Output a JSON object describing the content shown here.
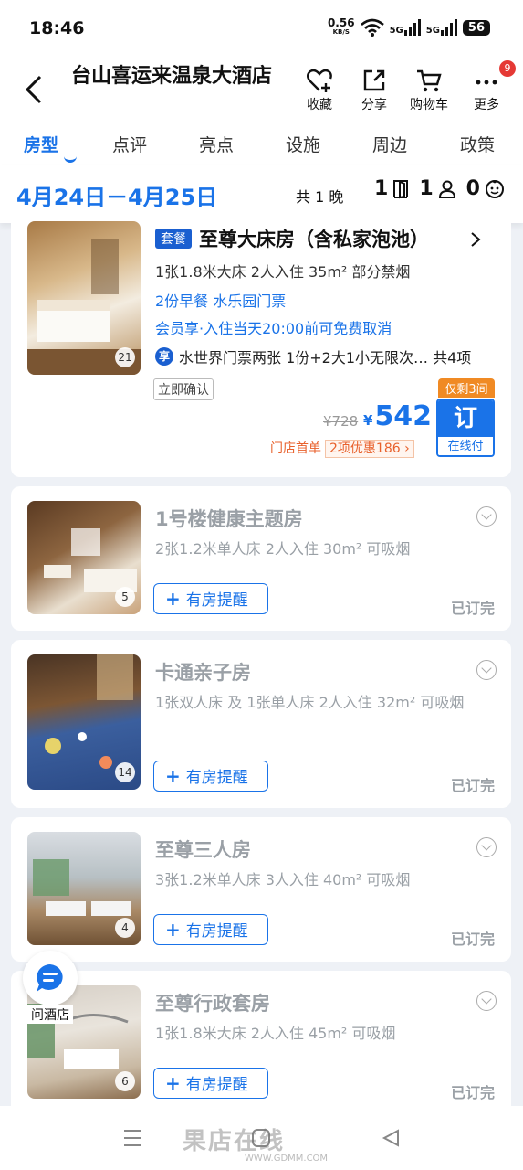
{
  "status": {
    "time": "18:46",
    "net_speed": "0.56",
    "net_unit": "KB/S",
    "sig1": "5G",
    "sig2": "5G",
    "battery": "56"
  },
  "header": {
    "title": "台山喜运来温泉大酒店",
    "actions": [
      {
        "label": "收藏",
        "icon": "heart-plus-icon"
      },
      {
        "label": "分享",
        "icon": "share-icon"
      },
      {
        "label": "购物车",
        "icon": "cart-icon"
      },
      {
        "label": "更多",
        "icon": "more-icon",
        "badge": "9"
      }
    ]
  },
  "tabs": [
    "房型",
    "点评",
    "亮点",
    "设施",
    "周边",
    "政策"
  ],
  "datebar": {
    "dates": "4月24日－4月25日",
    "nights": "共 1 晚",
    "rooms": "1",
    "adults": "1",
    "children": "0"
  },
  "featured": {
    "tag": "套餐",
    "name": "至尊大床房（含私家泡池）",
    "spec": "1张1.8米大床   2人入住   35m²   部分禁烟",
    "extras": "2份早餐   水乐园门票",
    "member": "会员享·入住当天20:00前可免费取消",
    "perk_icon": "享",
    "perk": "水世界门票两张 1份+2大1小无限次… 共4项",
    "photo_count": "21",
    "confirm": "立即确认",
    "old_price": "¥728",
    "currency": "¥",
    "price": "542",
    "only_left": "仅剩3间",
    "book_label": "订",
    "book_sub": "在线付",
    "deal_first": "门店首单",
    "deal_more": "2项优惠186 ›"
  },
  "rooms": [
    {
      "name": "1号楼健康主题房",
      "spec": "2张1.2米单人床  2人入住  30m²  可吸烟",
      "photos": "5",
      "remind": "有房提醒",
      "status": "已订完"
    },
    {
      "name": "卡通亲子房",
      "spec": "1张双人床 及 1张单人床  2人入住  32m²  可吸烟",
      "photos": "14",
      "remind": "有房提醒",
      "status": "已订完"
    },
    {
      "name": "至尊三人房",
      "spec": "3张1.2米单人床  3人入住  40m²  可吸烟",
      "photos": "4",
      "remind": "有房提醒",
      "status": "已订完"
    },
    {
      "name": "至尊行政套房",
      "spec": "1张1.8米大床  2人入住  45m²  可吸烟",
      "photos": "6",
      "remind": "有房提醒",
      "status": "已订完"
    }
  ],
  "ask": {
    "label": "问酒店"
  },
  "watermark": {
    "main": "果店在线",
    "sub": "WWW.GDMM.COM"
  }
}
